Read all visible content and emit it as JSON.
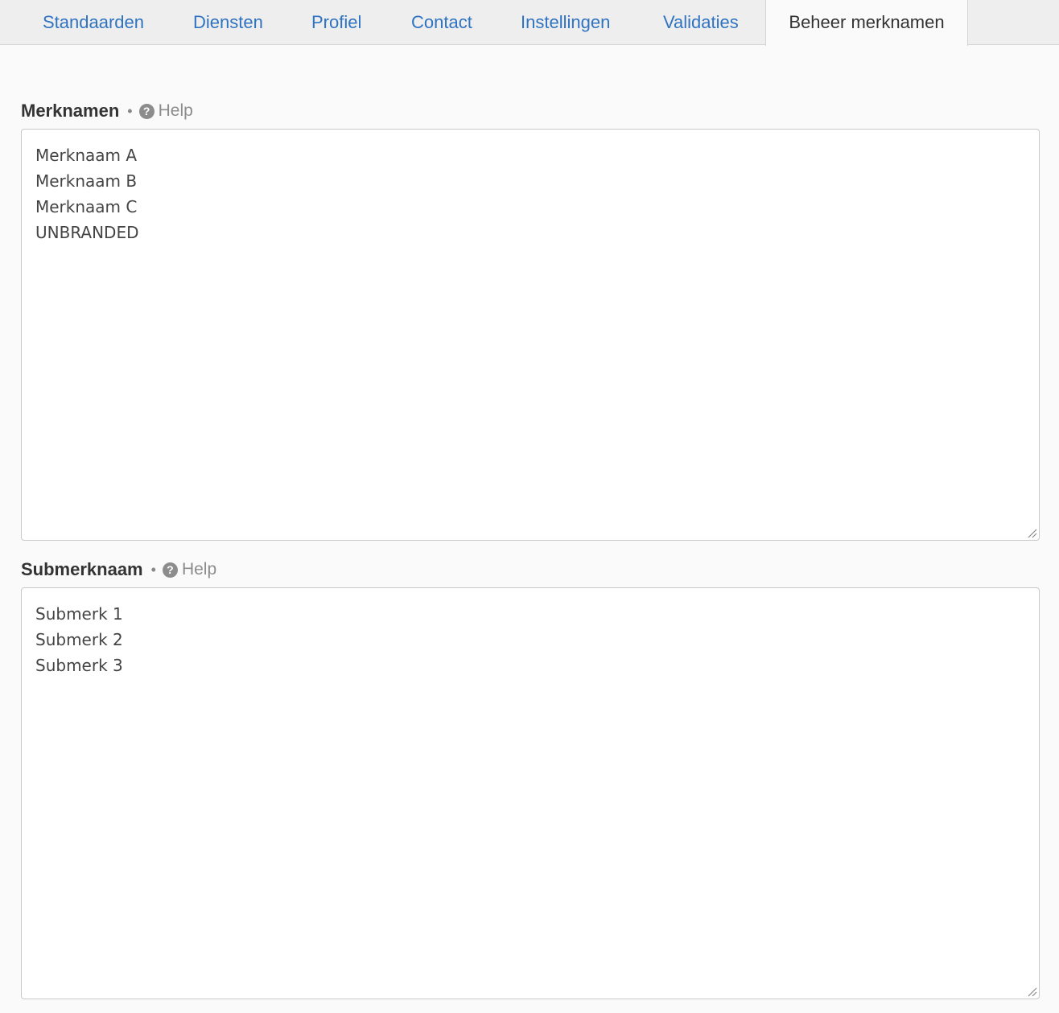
{
  "tabs": [
    {
      "label": "Standaarden"
    },
    {
      "label": "Diensten"
    },
    {
      "label": "Profiel"
    },
    {
      "label": "Contact"
    },
    {
      "label": "Instellingen"
    },
    {
      "label": "Validaties"
    },
    {
      "label": "Beheer merknamen",
      "active": true
    }
  ],
  "fields": {
    "merknamen": {
      "label": "Merknamen",
      "help": "Help",
      "value": "Merknaam A\nMerknaam B\nMerknaam C\nUNBRANDED"
    },
    "submerknaam": {
      "label": "Submerknaam",
      "help": "Help",
      "value": "Submerk 1\nSubmerk 2\nSubmerk 3"
    }
  },
  "icons": {
    "help": "question-circle-icon",
    "resize": "resize-grip-icon"
  },
  "colors": {
    "link": "#2f73c1",
    "active_tab_text": "#333333",
    "help_text": "#8c8c8c",
    "tabbar_bg": "#eeeeee",
    "page_bg": "#fafafa"
  }
}
